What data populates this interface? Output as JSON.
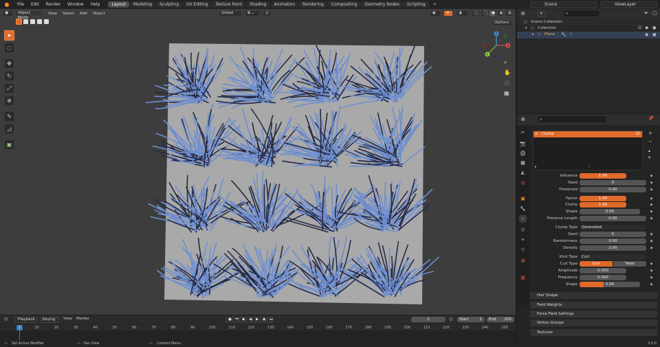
{
  "top_menu": {
    "items": [
      "File",
      "Edit",
      "Render",
      "Window",
      "Help"
    ],
    "workspaces": [
      "Layout",
      "Modeling",
      "Sculpting",
      "UV Editing",
      "Texture Paint",
      "Shading",
      "Animation",
      "Rendering",
      "Compositing",
      "Geometry Nodes",
      "Scripting"
    ],
    "active_workspace": "Layout",
    "add_tab": "+",
    "scene_name": "Scene",
    "view_layer": "ViewLayer"
  },
  "viewport_header": {
    "mode": "Object Mode",
    "menus": [
      "View",
      "Select",
      "Add",
      "Object"
    ],
    "transform": "Global",
    "options": "Options"
  },
  "toolbar": {
    "tools": [
      "select-box",
      "cursor",
      "move",
      "rotate",
      "scale",
      "transform",
      "annotate",
      "measure",
      "add-cube"
    ]
  },
  "gizmo": {
    "x": "X",
    "y": "Y",
    "z": "Z"
  },
  "outliner": {
    "root": "Scene Collection",
    "collection": "Collection",
    "object": "Plane"
  },
  "properties": {
    "modifier_name": "Clump",
    "fields": {
      "influence": {
        "label": "Influence",
        "value": "1.00"
      },
      "seed": {
        "label": "Seed",
        "value": "0"
      },
      "threshold": {
        "label": "Threshold",
        "value": "0.00"
      },
      "factor": {
        "label": "Factor",
        "value": "1.00"
      },
      "clump": {
        "label": "Clump",
        "value": "1.00"
      },
      "shape": {
        "label": "Shape",
        "value": "0.00"
      },
      "preserve_length": {
        "label": "Preserve Length",
        "value": "0.00"
      },
      "clump_type": {
        "label": "Clump Type",
        "value": "Generated"
      },
      "seed2": {
        "label": "Seed",
        "value": "0"
      },
      "randomness": {
        "label": "Randomness",
        "value": "0.00"
      },
      "density": {
        "label": "Density",
        "value": "2.00"
      },
      "kink_type": {
        "label": "Kink Type",
        "value": "Curl"
      },
      "curl_type": {
        "label": "Curl Type",
        "option_a": "Curl",
        "option_b": "Twist"
      },
      "amplitude": {
        "label": "Amplitude",
        "value": "0.000"
      },
      "frequency": {
        "label": "Frequency",
        "value": "0.000"
      },
      "shape2": {
        "label": "Shape",
        "value": "0.00"
      }
    },
    "sections": [
      "Hair Shape",
      "Field Weights",
      "Force Field Settings",
      "Vertex Groups",
      "Textures"
    ]
  },
  "timeline": {
    "menus": [
      "Playback",
      "Keying",
      "View",
      "Marker"
    ],
    "current_frame": "1",
    "start_label": "Start",
    "start": "1",
    "end_label": "End",
    "end": "250",
    "ticks": [
      "1",
      "10",
      "20",
      "30",
      "40",
      "50",
      "60",
      "70",
      "80",
      "90",
      "100",
      "110",
      "120",
      "130",
      "140",
      "150",
      "160",
      "170",
      "180",
      "190",
      "200",
      "210",
      "220",
      "230",
      "240",
      "250"
    ]
  },
  "statusbar": {
    "left": "Set Active Modifier",
    "middle": "Pan View",
    "right": "Context Menu",
    "version": "3.0.0"
  },
  "colors": {
    "accent": "#e06a2a",
    "hair": "#6f8fd0",
    "hair_dark": "#252a45",
    "plane": "#a9a9a9",
    "viewport_bg": "#3d3d3d"
  }
}
